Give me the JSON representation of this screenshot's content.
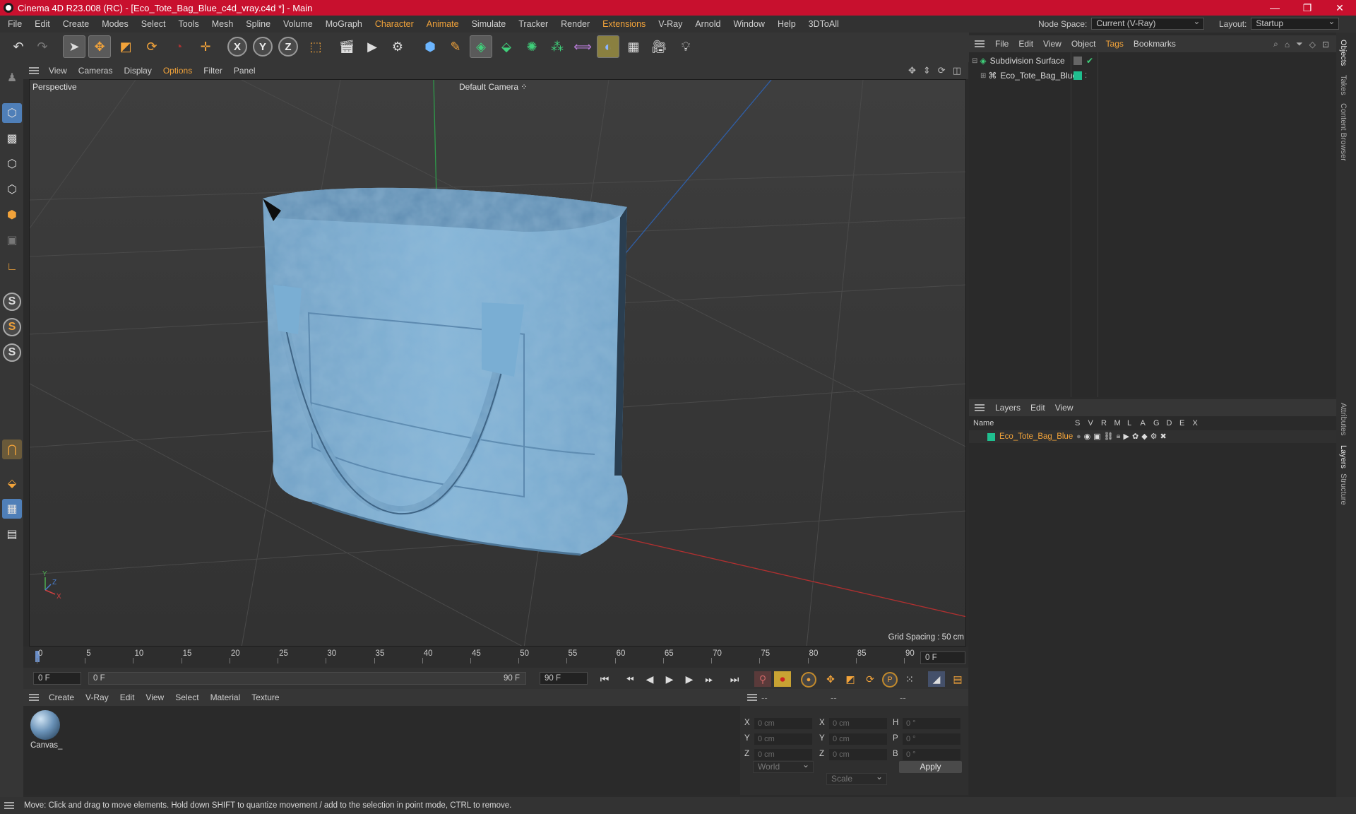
{
  "window": {
    "title": "Cinema 4D R23.008 (RC) - [Eco_Tote_Bag_Blue_c4d_vray.c4d *] - Main",
    "minimize": "—",
    "restore": "❐",
    "close": "✕"
  },
  "menubar": {
    "items": [
      "File",
      "Edit",
      "Create",
      "Modes",
      "Select",
      "Tools",
      "Mesh",
      "Spline",
      "Volume",
      "MoGraph",
      "Character",
      "Animate",
      "Simulate",
      "Tracker",
      "Render",
      "Extensions",
      "V-Ray",
      "Arnold",
      "Window",
      "Help",
      "3DToAll"
    ],
    "highlighted": [
      "Character",
      "Animate",
      "Extensions"
    ],
    "node_space_label": "Node Space:",
    "node_space_value": "Current (V-Ray)",
    "layout_label": "Layout:",
    "layout_value": "Startup"
  },
  "toolbar": {
    "icons": [
      "undo-icon",
      "redo-icon",
      "select-live-icon",
      "move-icon",
      "scale-icon",
      "rotate-icon",
      "recent-tool-icon",
      "create-axis-icon",
      "axis-x-icon",
      "axis-y-icon",
      "axis-z-icon",
      "coordinate-system-icon",
      "render-view-icon",
      "render-picture-viewer-icon",
      "render-settings-icon",
      "cube-icon",
      "pen-spline-icon",
      "subdivision-icon",
      "extrude-icon",
      "cloner-icon",
      "mograph-icon",
      "symmetry-icon",
      "deformer-icon",
      "floor-icon",
      "camera-icon",
      "light-icon"
    ],
    "axis_labels": [
      "X",
      "Y",
      "Z"
    ]
  },
  "viewport": {
    "menu": [
      "View",
      "Cameras",
      "Display",
      "Options",
      "Filter",
      "Panel"
    ],
    "highlighted": "Options",
    "projection": "Perspective",
    "camera": "Default Camera",
    "grid_spacing": "Grid Spacing : 50 cm",
    "axis_y": "Y",
    "axis_z": "Z",
    "axis_x": "X"
  },
  "timeline": {
    "ticks": [
      "0",
      "5",
      "10",
      "15",
      "20",
      "25",
      "30",
      "35",
      "40",
      "45",
      "50",
      "55",
      "60",
      "65",
      "70",
      "75",
      "80",
      "85",
      "90"
    ],
    "current_frame": "0 F",
    "start": "0 F",
    "range_start": "0 F",
    "range_end": "90 F",
    "end": "90 F"
  },
  "material_manager": {
    "menu": [
      "Create",
      "V-Ray",
      "Edit",
      "View",
      "Select",
      "Material",
      "Texture"
    ],
    "materials": [
      {
        "name": "Canvas_"
      }
    ]
  },
  "coordinates": {
    "head": [
      "--",
      "--",
      "--"
    ],
    "rows": [
      {
        "l1": "X",
        "v1": "0 cm",
        "l2": "X",
        "v2": "0 cm",
        "l3": "H",
        "v3": "0 °"
      },
      {
        "l1": "Y",
        "v1": "0 cm",
        "l2": "Y",
        "v2": "0 cm",
        "l3": "P",
        "v3": "0 °"
      },
      {
        "l1": "Z",
        "v1": "0 cm",
        "l2": "Z",
        "v2": "0 cm",
        "l3": "B",
        "v3": "0 °"
      }
    ],
    "space": "World",
    "mode": "Scale",
    "apply": "Apply"
  },
  "objects": {
    "menu": [
      "File",
      "Edit",
      "View",
      "Object",
      "Tags",
      "Bookmarks"
    ],
    "highlighted": "Tags",
    "items": [
      {
        "name": "Subdivision Surface"
      },
      {
        "name": "Eco_Tote_Bag_Blue"
      }
    ]
  },
  "layers": {
    "menu": [
      "Layers",
      "Edit",
      "View"
    ],
    "columns": [
      "Name",
      "S",
      "V",
      "R",
      "M",
      "L",
      "A",
      "G",
      "D",
      "E",
      "X"
    ],
    "items": [
      {
        "name": "Eco_Tote_Bag_Blue",
        "color": "#1fbf8f"
      }
    ]
  },
  "side_tabs": [
    "Objects",
    "Takes",
    "Content Browser",
    "Attributes",
    "Layers",
    "Structure"
  ],
  "status": {
    "text": "Move: Click and drag to move elements. Hold down SHIFT to quantize movement / add to the selection in point mode, CTRL to remove."
  },
  "colors": {
    "title_bar": "#c8102e",
    "accent": "#f2a33a",
    "layer_color": "#1fbf8f",
    "bag": "#7fb2d6"
  }
}
